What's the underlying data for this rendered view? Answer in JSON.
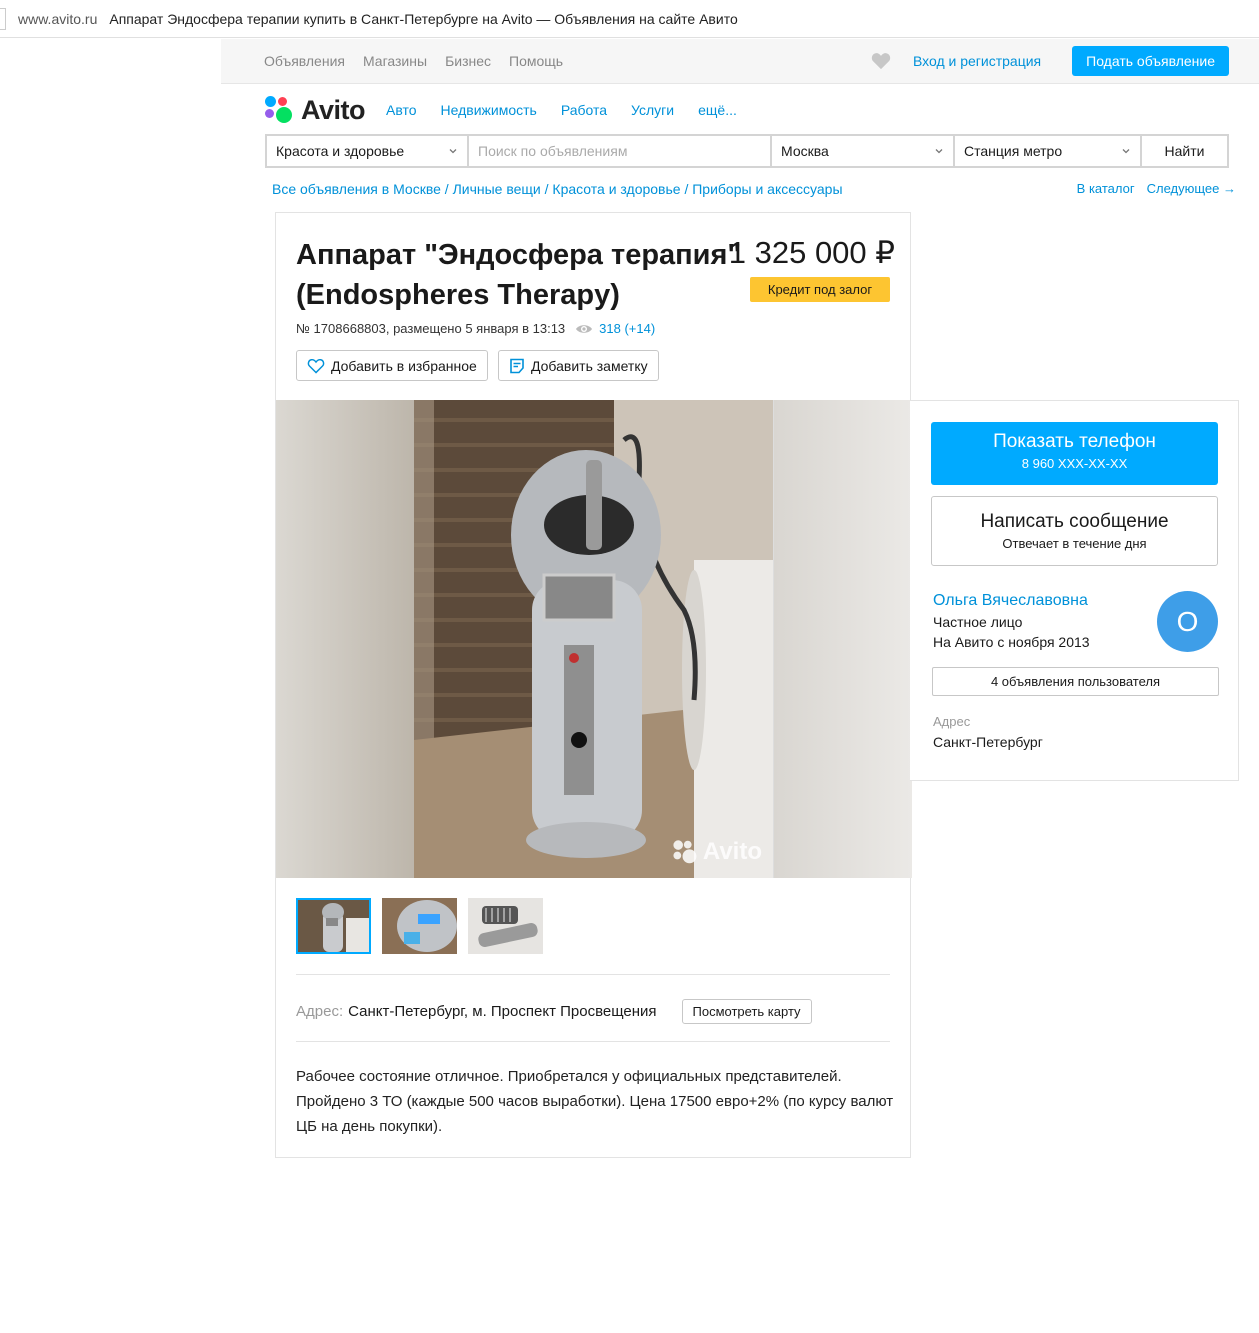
{
  "browser": {
    "domain": "www.avito.ru",
    "title": "Аппарат Эндосфера терапии купить в Санкт-Петербурге на Avito — Объявления на сайте Авито"
  },
  "topnav": {
    "links": [
      "Объявления",
      "Магазины",
      "Бизнес",
      "Помощь"
    ],
    "login": "Вход и регистрация",
    "post_ad": "Подать объявление"
  },
  "logo": {
    "text": "Avito"
  },
  "categories": [
    "Авто",
    "Недвижимость",
    "Работа",
    "Услуги",
    "ещё..."
  ],
  "search": {
    "category": "Красота и здоровье",
    "query_placeholder": "Поиск по объявлениям",
    "city": "Москва",
    "metro": "Станция метро",
    "find": "Найти"
  },
  "breadcrumbs": "Все объявления в Москве / Личные вещи / Красота и здоровье / Приборы и аксессуары",
  "crumbs_right": {
    "catalog": "В каталог",
    "next": "Следующее →"
  },
  "item": {
    "title": "Аппарат \"Эндосфера терапия\" (Endospheres Therapy)",
    "meta": "№ 1708668803, размещено 5 января в 13:13",
    "views": "318 (+14)",
    "fav_button": "Добавить в избранное",
    "note_button": "Добавить заметку",
    "price": "1 325 000 ₽",
    "credit": "Кредит под залог",
    "watermark": "Avito",
    "address_label": "Адрес:",
    "address": "Санкт-Петербург, м. Проспект Просвещения",
    "map_button": "Посмотреть карту",
    "description": "Рабочее состояние отличное. Приобретался у официальных представителей. Пройдено 3 ТО (каждые 500 часов выработки). Цена 17500 евро+2% (по курсу валют ЦБ на день покупки)."
  },
  "seller": {
    "phone_title": "Показать телефон",
    "phone_number": "8 960 XXX-XX-XX",
    "message_title": "Написать сообщение",
    "message_sub": "Отвечает в течение дня",
    "name": "Ольга Вячеславовна",
    "type": "Частное лицо",
    "since": "На Авито с ноября 2013",
    "avatar_letter": "О",
    "ads": "4 объявления пользователя",
    "address_label": "Адрес",
    "address": "Санкт-Петербург"
  },
  "colors": {
    "accent": "#00aaff",
    "link": "#0091d9",
    "credit": "#fdc531",
    "avatar": "#3e9ee8"
  }
}
